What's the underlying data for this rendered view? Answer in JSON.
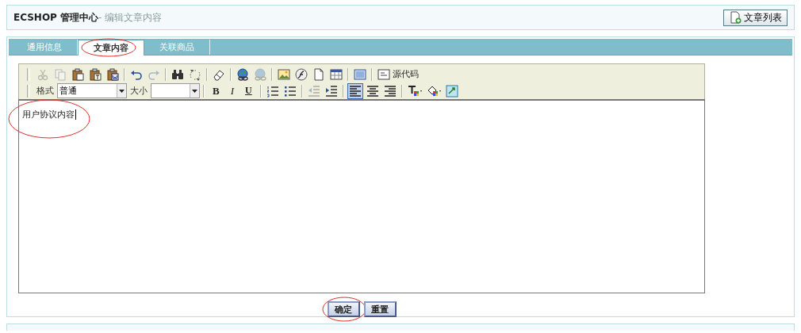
{
  "header": {
    "title": "ECSHOP 管理中心",
    "subtitle": "- 编辑文章内容",
    "action_button": "文章列表"
  },
  "tabs": [
    {
      "label": "通用信息",
      "selected": false
    },
    {
      "label": "文章内容",
      "selected": true
    },
    {
      "label": "关联商品",
      "selected": false
    }
  ],
  "editor": {
    "toolbar_rows": [
      [
        {
          "kind": "cut",
          "disabled": true
        },
        {
          "kind": "copy",
          "disabled": true
        },
        {
          "kind": "paste",
          "disabled": false
        },
        {
          "kind": "paste-text",
          "disabled": false
        },
        {
          "kind": "paste-word",
          "disabled": false
        },
        {
          "kind": "sep"
        },
        {
          "kind": "undo",
          "disabled": false
        },
        {
          "kind": "redo",
          "disabled": true
        },
        {
          "kind": "sep"
        },
        {
          "kind": "find",
          "disabled": false
        },
        {
          "kind": "replace",
          "disabled": false
        },
        {
          "kind": "sep"
        },
        {
          "kind": "eraser",
          "disabled": false
        },
        {
          "kind": "sep"
        },
        {
          "kind": "link",
          "disabled": false
        },
        {
          "kind": "unlink",
          "disabled": true
        },
        {
          "kind": "sep"
        },
        {
          "kind": "image",
          "disabled": false
        },
        {
          "kind": "flash",
          "disabled": false
        },
        {
          "kind": "page",
          "disabled": false
        },
        {
          "kind": "table",
          "disabled": false
        },
        {
          "kind": "sep"
        },
        {
          "kind": "frame",
          "disabled": false
        },
        {
          "kind": "sep"
        },
        {
          "kind": "source",
          "label": "源代码"
        }
      ],
      [
        {
          "kind": "label",
          "text": "格式"
        },
        {
          "kind": "select",
          "value": "普通"
        },
        {
          "kind": "label",
          "text": "大小"
        },
        {
          "kind": "select-empty"
        },
        {
          "kind": "sep"
        },
        {
          "kind": "bold",
          "text": "B"
        },
        {
          "kind": "italic",
          "text": "I"
        },
        {
          "kind": "underline",
          "text": "U"
        },
        {
          "kind": "sep"
        },
        {
          "kind": "ol",
          "disabled": false
        },
        {
          "kind": "ul",
          "disabled": false
        },
        {
          "kind": "sep"
        },
        {
          "kind": "outdent",
          "disabled": true
        },
        {
          "kind": "indent",
          "disabled": false
        },
        {
          "kind": "sep"
        },
        {
          "kind": "align-left",
          "selected": true
        },
        {
          "kind": "align-center",
          "selected": false
        },
        {
          "kind": "align-right",
          "selected": false
        },
        {
          "kind": "sep"
        },
        {
          "kind": "text-color",
          "disabled": false
        },
        {
          "kind": "bg-color",
          "disabled": false
        },
        {
          "kind": "fullscreen",
          "disabled": false
        }
      ]
    ],
    "content": "用户协议内容"
  },
  "buttons": [
    {
      "label": "确定"
    },
    {
      "label": "重置"
    }
  ]
}
